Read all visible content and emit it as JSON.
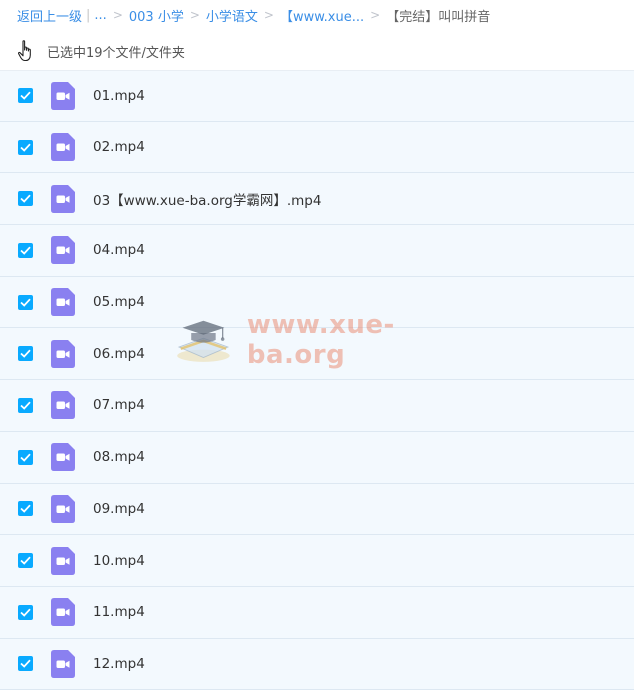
{
  "breadcrumb": {
    "back": "返回上一级",
    "ellipsis": "...",
    "items": [
      "003 小学",
      "小学语文",
      "【www.xue..."
    ],
    "current": "【完结】叫叫拼音"
  },
  "selection": {
    "status": "已选中19个文件/文件夹"
  },
  "files": [
    {
      "name": "01.mp4",
      "checked": true
    },
    {
      "name": "02.mp4",
      "checked": true
    },
    {
      "name": "03【www.xue-ba.org学霸网】.mp4",
      "checked": true
    },
    {
      "name": "04.mp4",
      "checked": true
    },
    {
      "name": "05.mp4",
      "checked": true
    },
    {
      "name": "06.mp4",
      "checked": true
    },
    {
      "name": "07.mp4",
      "checked": true
    },
    {
      "name": "08.mp4",
      "checked": true
    },
    {
      "name": "09.mp4",
      "checked": true
    },
    {
      "name": "10.mp4",
      "checked": true
    },
    {
      "name": "11.mp4",
      "checked": true
    },
    {
      "name": "12.mp4",
      "checked": true
    }
  ],
  "watermark": {
    "text": "www.xue-ba.org"
  },
  "colors": {
    "accent": "#3a8ee6",
    "checkbox": "#09aaff",
    "video_icon": "#8a80f0",
    "row_bg": "#f3f9fe"
  }
}
